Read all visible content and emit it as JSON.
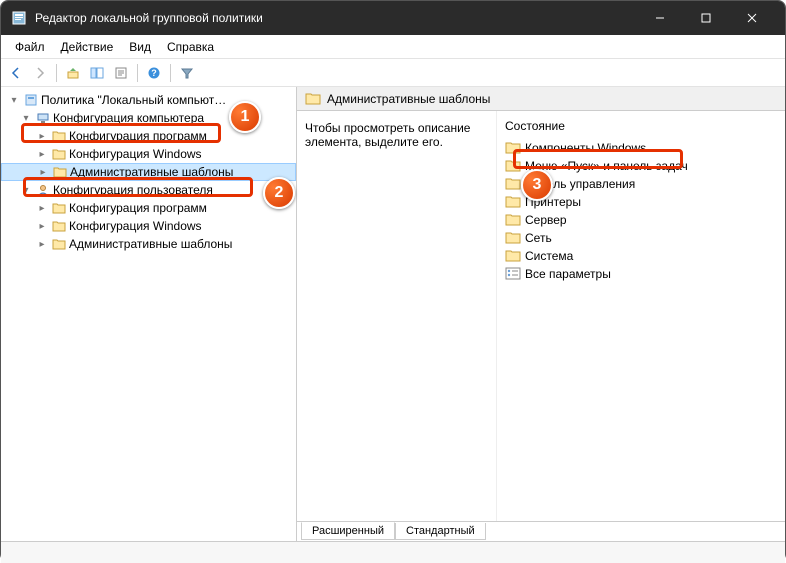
{
  "window": {
    "title": "Редактор локальной групповой политики"
  },
  "menu": {
    "file": "Файл",
    "action": "Действие",
    "view": "Вид",
    "help": "Справка"
  },
  "tree": {
    "root": "Политика \"Локальный компьют…",
    "comp_config": "Конфигурация компьютера",
    "comp_programs": "Конфигурация программ",
    "comp_windows": "Конфигурация Windows",
    "comp_admin": "Административные шаблоны",
    "user_config": "Конфигурация пользователя",
    "user_programs": "Конфигурация программ",
    "user_windows": "Конфигурация Windows",
    "user_admin": "Административные шаблоны"
  },
  "content": {
    "header": "Административные шаблоны",
    "desc": "Чтобы просмотреть описание элемента, выделите его.",
    "state_header": "Состояние",
    "items": {
      "components": "Компоненты Windows",
      "startmenu": "Меню «Пуск» и панель задач",
      "controlpanel": "Панель управления",
      "printers": "Принтеры",
      "server": "Сервер",
      "network": "Сеть",
      "system": "Система",
      "allsettings": "Все параметры"
    }
  },
  "tabs": {
    "extended": "Расширенный",
    "standard": "Стандартный"
  },
  "callouts": {
    "c1": "1",
    "c2": "2",
    "c3": "3"
  }
}
